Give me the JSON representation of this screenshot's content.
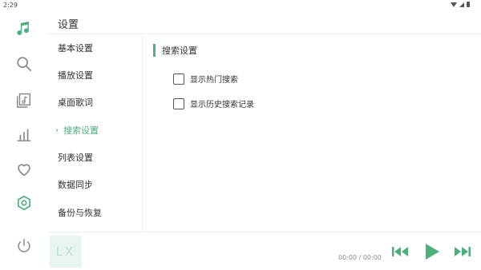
{
  "status_bar": {
    "time": "2:29"
  },
  "header": {
    "title": "设置"
  },
  "menu": {
    "items": [
      {
        "label": "基本设置",
        "active": false
      },
      {
        "label": "播放设置",
        "active": false
      },
      {
        "label": "桌面歌词",
        "active": false
      },
      {
        "label": "搜索设置",
        "active": true
      },
      {
        "label": "列表设置",
        "active": false
      },
      {
        "label": "数据同步",
        "active": false
      },
      {
        "label": "备份与恢复",
        "active": false
      }
    ]
  },
  "content": {
    "section_title": "搜索设置",
    "options": [
      {
        "label": "显示热门搜索",
        "checked": false
      },
      {
        "label": "显示历史搜索记录",
        "checked": false
      }
    ]
  },
  "player": {
    "cover_text": "LX",
    "time": "00:00 / 00:00"
  },
  "colors": {
    "accent": "#4daf7c",
    "icon": "#888888",
    "text": "#333333"
  },
  "icons": {
    "nav": [
      "music-note-icon",
      "search-icon",
      "music-list-icon",
      "leaderboard-icon",
      "heart-icon",
      "settings-icon",
      "power-icon"
    ],
    "player": [
      "skip-previous-icon",
      "play-icon",
      "skip-next-icon"
    ]
  }
}
